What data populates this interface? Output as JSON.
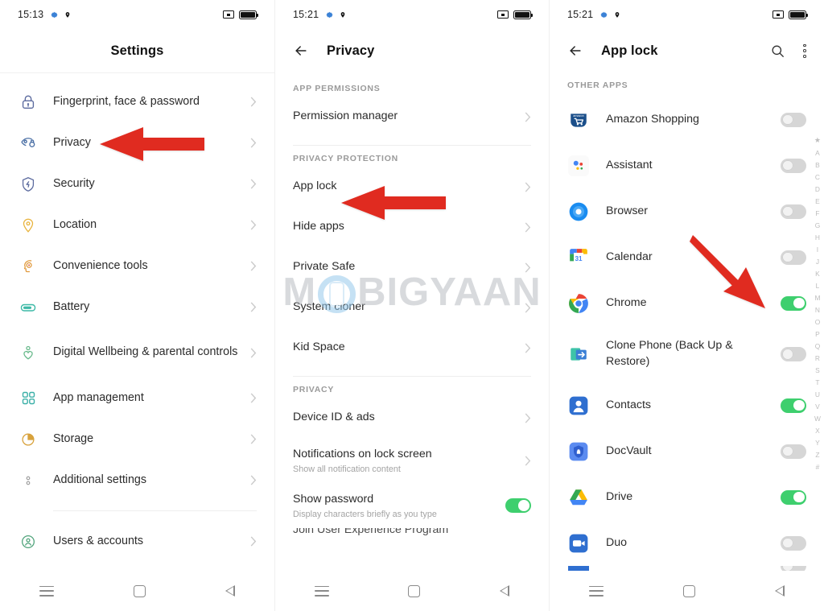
{
  "colors": {
    "accent_green": "#3ecf6e",
    "arrow_red": "#e02b20",
    "toggle_off": "#d6d6d6",
    "text_primary": "#2b2b2b",
    "text_secondary": "#a4a4a4",
    "section_label": "#9a9a9a"
  },
  "panel_settings": {
    "status_bar": {
      "time": "15:13",
      "icons_left": [
        "gear-icon",
        "location-pin-icon"
      ],
      "icons_right": [
        "cast-icon",
        "battery-icon"
      ]
    },
    "title": "Settings",
    "items": [
      {
        "label": "Fingerprint, face & password",
        "icon": "lock-icon",
        "icon_color": "#5b6a9e"
      },
      {
        "label": "Privacy",
        "icon": "privacy-eye-icon",
        "icon_color": "#4a6fa5"
      },
      {
        "label": "Security",
        "icon": "shield-icon",
        "icon_color": "#5b6a9e"
      },
      {
        "label": "Location",
        "icon": "map-pin-icon",
        "icon_color": "#e8b33c"
      },
      {
        "label": "Convenience tools",
        "icon": "head-gear-icon",
        "icon_color": "#e0993c"
      },
      {
        "label": "Battery",
        "icon": "battery-icon",
        "icon_color": "#3cb9a6"
      },
      {
        "label": "Digital Wellbeing & parental controls",
        "icon": "heart-person-icon",
        "icon_color": "#67b98a"
      },
      {
        "label": "App management",
        "icon": "grid-apps-icon",
        "icon_color": "#3cb0a8"
      },
      {
        "label": "Storage",
        "icon": "pie-chart-icon",
        "icon_color": "#d8a23c"
      },
      {
        "label": "Additional settings",
        "icon": "two-dots-icon",
        "icon_color": "#8a8a8a"
      }
    ],
    "items_after_divider": [
      {
        "label": "Users & accounts",
        "icon": "user-circle-icon",
        "icon_color": "#4fa37a"
      }
    ],
    "nav": [
      "recents-icon",
      "home-icon",
      "back-icon"
    ]
  },
  "panel_privacy": {
    "status_bar": {
      "time": "15:21"
    },
    "title": "Privacy",
    "back_icon": "back-arrow-icon",
    "sections": [
      {
        "label": "APP PERMISSIONS",
        "items": [
          {
            "label": "Permission manager",
            "type": "chevron"
          }
        ]
      },
      {
        "label": "PRIVACY PROTECTION",
        "items": [
          {
            "label": "App lock",
            "type": "chevron"
          },
          {
            "label": "Hide apps",
            "type": "chevron"
          },
          {
            "label": "Private Safe",
            "type": "chevron"
          },
          {
            "label": "System cloner",
            "type": "chevron"
          },
          {
            "label": "Kid Space",
            "type": "chevron"
          }
        ]
      },
      {
        "label": "PRIVACY",
        "items": [
          {
            "label": "Device ID & ads",
            "type": "chevron"
          },
          {
            "label": "Notifications on lock screen",
            "sub": "Show all notification content",
            "type": "chevron"
          },
          {
            "label": "Show password",
            "sub": "Display characters briefly as you type",
            "type": "toggle",
            "toggle": "on"
          }
        ]
      }
    ],
    "cutoff_row": "Join User Experience Program"
  },
  "panel_applock": {
    "status_bar": {
      "time": "15:21"
    },
    "title": "App lock",
    "back_icon": "back-arrow-icon",
    "actions": [
      "search-icon",
      "overflow-menu-icon"
    ],
    "section_label": "OTHER APPS",
    "apps": [
      {
        "name": "Amazon Shopping",
        "icon": "amazon-icon",
        "toggle": "off"
      },
      {
        "name": "Assistant",
        "icon": "assistant-icon",
        "toggle": "off"
      },
      {
        "name": "Browser",
        "icon": "browser-icon",
        "toggle": "off"
      },
      {
        "name": "Calendar",
        "icon": "calendar-icon",
        "toggle": "off"
      },
      {
        "name": "Chrome",
        "icon": "chrome-icon",
        "toggle": "on"
      },
      {
        "name": "Clone Phone (Back Up & Restore)",
        "icon": "clone-phone-icon",
        "toggle": "off"
      },
      {
        "name": "Contacts",
        "icon": "contacts-icon",
        "toggle": "on"
      },
      {
        "name": "DocVault",
        "icon": "docvault-icon",
        "toggle": "off"
      },
      {
        "name": "Drive",
        "icon": "drive-icon",
        "toggle": "on"
      },
      {
        "name": "Duo",
        "icon": "duo-icon",
        "toggle": "off"
      }
    ],
    "alphabet_index": [
      "★",
      "A",
      "B",
      "C",
      "D",
      "E",
      "F",
      "G",
      "H",
      "I",
      "J",
      "K",
      "L",
      "M",
      "N",
      "O",
      "P",
      "Q",
      "R",
      "S",
      "T",
      "U",
      "V",
      "W",
      "X",
      "Y",
      "Z",
      "#"
    ]
  },
  "watermark": {
    "text_before": "M",
    "text_after": "BIGYAAN"
  },
  "annotations": [
    {
      "name": "arrow-to-privacy",
      "points_to": "Privacy"
    },
    {
      "name": "arrow-to-app-lock",
      "points_to": "App lock"
    },
    {
      "name": "arrow-to-chrome-toggle",
      "points_to": "Chrome toggle"
    }
  ]
}
